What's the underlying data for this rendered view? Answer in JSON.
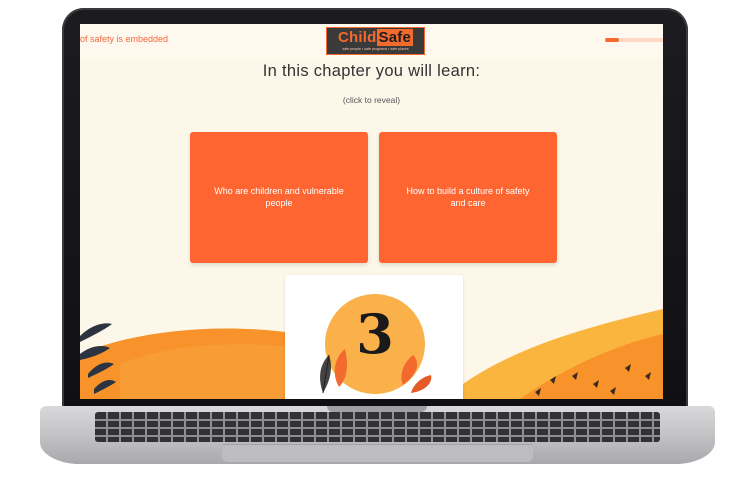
{
  "topbar": {
    "breadcrumb_text": "of safety is embedded",
    "progress_fraction": 0.22
  },
  "logo": {
    "word_part1": "Child",
    "word_part2": "Safe",
    "tagline": "safe people • safe programs • safe places"
  },
  "main": {
    "heading": "In this chapter you will learn:",
    "subheading": "(click to reveal)",
    "cards": [
      {
        "label": "Who are children and vulnerable people"
      },
      {
        "label": "How to build a culture of safety and care"
      }
    ],
    "chapter_number": "3"
  },
  "colors": {
    "accent": "#fe6531",
    "background": "#fdf7ea",
    "chapter_circle": "#fbb14a",
    "hill_orange": "#f7932a",
    "hill_light": "#f9b53e"
  },
  "icons": [
    "leaf-icon",
    "feather-icon",
    "palm-leaf-icon"
  ]
}
